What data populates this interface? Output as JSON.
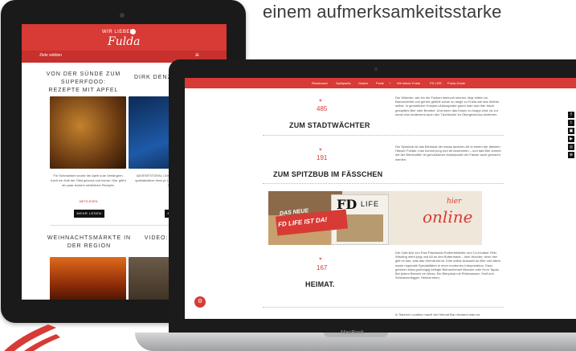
{
  "headline": "einem aufmerksamkeitsstarke",
  "colors": {
    "brand_red": "#d83a35",
    "dark": "#1a1a1a"
  },
  "tablet": {
    "logo_small": "WIR LIEBEN",
    "logo_big": "Fulda",
    "nav_label": "Ziele wählen",
    "menu_icon": "hamburger-icon",
    "articles": [
      {
        "title": "VON DER SÜNDE ZUM SUPERFOOD: REZEPTE MIT APFEL",
        "text": "Für Schmankerl wurde der Apfel zum Verlängern. Auch ein Kalt der Obst gesund und immer. Hier gibt's ein paar leckere winterliche Rezepte.",
        "more": "WEITLESEN",
        "button": "MEHR LESEN"
      },
      {
        "title": "DIRK DENZERS VARIETÉ: AN...",
        "text": "ADVENTSTORAL | Dirk Denzer, Wenner Varieté zaubert spektakulärer denn je 11. Show vom 26. bis 29. Dezember Showgäste...",
        "more": "",
        "button": "MEHR LESEN"
      },
      {
        "title": "WEIHNACHTSMÄRKTE IN DER REGION",
        "text": "",
        "more": "",
        "button": ""
      },
      {
        "title": "VIDEO: GRILLEG... DER KNESH...",
        "text": "",
        "more": "",
        "button": ""
      }
    ]
  },
  "laptop": {
    "nav": [
      "Restaurant",
      "Spielparks",
      "Gastro",
      "Feste",
      "+",
      "Wir lieben Fulda",
      "FD LIFE",
      "Fulda-Guide"
    ],
    "cards": [
      {
        "count": "485",
        "name": "ZUM STADTWÄCHTER",
        "desc": "Der Wächter, wie ihn die Fuldaer liebevoll nennen, liegt mitten im Barockviertel und gehört gefühlt schon so lange zu Fulda wie das Weiher selbst. In gemütlicher Kneipen-Atmosphäre gönnt man sich hier frisch gezapftes Bier oder Bembel. Und wenn das Essen zu knapp wird, ist zur sonst eins bedienend auch den Tischlecker im Obergeschoss bedienen."
      },
      {
        "count": "191",
        "name": "ZUM SPITZBUB IM FÄSSCHEN",
        "desc": "Der Spitzbub ist das Bierlokal der etwas anderen Art in einem der ältesten Häuser Fuldas: man kommt jung und alt zusammen – und das Bier kommt mit der Biershuttle! Ist genüsslicher Anlaufpunkt der Fässer auch gemacht werden."
      },
      {
        "count": "167",
        "name": "HEIMAT.",
        "desc": "Die Café-Bar von Paul Pawlowski Rotherlebdeller und Co-Inhaber Felix Wissling steht jung und All an den Buttermarkt – kein Wunder, denn hier gibt es das, was das Heimat kennt. Eine solide Auswahl an Bier und allem sowie regionale Spezialitäten in einer modernen Interpretation. Dazu gehören etwa großzügig belegte Bütmenbemel Brauser oder Kron Tapas. Bei jedem Besuch ein Muss: Ein Bierpokal mit Rhönwasser, Smif und Schwarzenegger. Heimat eben."
      }
    ],
    "banner": {
      "mag_logo": "FD",
      "mag_life": "LIFE",
      "ribbon_line1": "DAS NEUE",
      "ribbon_line2": "FD LIFE IST DA!",
      "hier": "hier",
      "online": "online"
    },
    "footer_text": "In Sachen Location macht der Heimat Bar niemand was vor.",
    "social_icons": [
      "f",
      "t",
      "▣",
      "▶",
      "◎",
      "⊕"
    ],
    "brand": "MacBook"
  }
}
